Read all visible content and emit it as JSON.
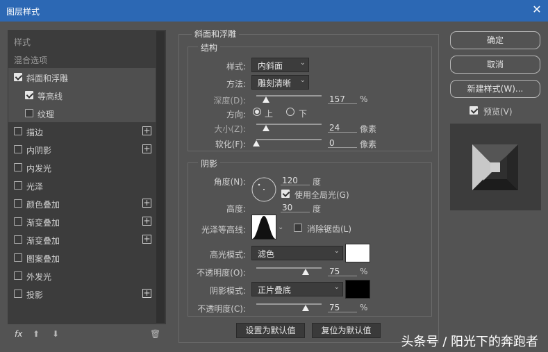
{
  "window": {
    "title": "图层样式",
    "close_glyph": "✕"
  },
  "styles_list": {
    "header": "样式",
    "blending": "混合选项",
    "items": [
      {
        "label": "斜面和浮雕",
        "checked": true,
        "plus": false
      },
      {
        "label": "等高线",
        "checked": true,
        "plus": false
      },
      {
        "label": "纹理",
        "checked": false,
        "plus": false
      },
      {
        "label": "描边",
        "checked": false,
        "plus": true
      },
      {
        "label": "内阴影",
        "checked": false,
        "plus": true
      },
      {
        "label": "内发光",
        "checked": false,
        "plus": false
      },
      {
        "label": "光泽",
        "checked": false,
        "plus": false
      },
      {
        "label": "颜色叠加",
        "checked": false,
        "plus": true
      },
      {
        "label": "渐变叠加",
        "checked": false,
        "plus": true
      },
      {
        "label": "渐变叠加",
        "checked": false,
        "plus": true
      },
      {
        "label": "图案叠加",
        "checked": false,
        "plus": false
      },
      {
        "label": "外发光",
        "checked": false,
        "plus": false
      },
      {
        "label": "投影",
        "checked": false,
        "plus": true
      }
    ],
    "bottom": {
      "fx": "fx",
      "up_glyph": "⬆",
      "down_glyph": "⬇",
      "trash_glyph": "🗑"
    },
    "plus_glyph": "+"
  },
  "bevel": {
    "title": "斜面和浮雕",
    "structure": {
      "title": "结构",
      "style_label": "样式:",
      "style_value": "内斜面",
      "technique_label": "方法:",
      "technique_value": "雕刻清晰",
      "depth_label": "深度(D):",
      "depth_value": "157",
      "depth_unit": "%",
      "depth_fraction": 0.15,
      "direction_label": "方向:",
      "dir_up": "上",
      "dir_down": "下",
      "direction_selected": "上",
      "size_label": "大小(Z):",
      "size_value": "24",
      "size_unit": "像素",
      "size_fraction": 0.15,
      "soften_label": "软化(F):",
      "soften_value": "0",
      "soften_unit": "像素",
      "soften_fraction": 0.0
    },
    "shading": {
      "title": "阴影",
      "angle_label": "角度(N):",
      "angle_value": "120",
      "angle_unit": "度",
      "global_light_label": "使用全局光(G)",
      "global_light": true,
      "altitude_label": "高度:",
      "altitude_value": "30",
      "altitude_unit": "度",
      "gloss_label": "光泽等高线:",
      "antialias_label": "消除锯齿(L)",
      "antialias": false,
      "highlight_mode_label": "高光模式:",
      "highlight_mode_value": "滤色",
      "highlight_color": "#ffffff",
      "highlight_opacity_label": "不透明度(O):",
      "highlight_opacity_value": "75",
      "highlight_opacity_fraction": 0.75,
      "shadow_mode_label": "阴影模式:",
      "shadow_mode_value": "正片叠底",
      "shadow_color": "#000000",
      "shadow_opacity_label": "不透明度(C):",
      "shadow_opacity_value": "75",
      "shadow_opacity_fraction": 0.75,
      "percent": "%"
    },
    "make_default": "设置为默认值",
    "reset_default": "复位为默认值"
  },
  "buttons": {
    "ok": "确定",
    "cancel": "取消",
    "new_style": "新建样式(W)...",
    "preview_label": "预览(V)",
    "preview_checked": true
  },
  "watermark": "头条号 / 阳光下的奔跑者",
  "colors": {
    "titlebar": "#2c68b4",
    "panel": "#535353",
    "list_bg": "#3c3c3c"
  }
}
